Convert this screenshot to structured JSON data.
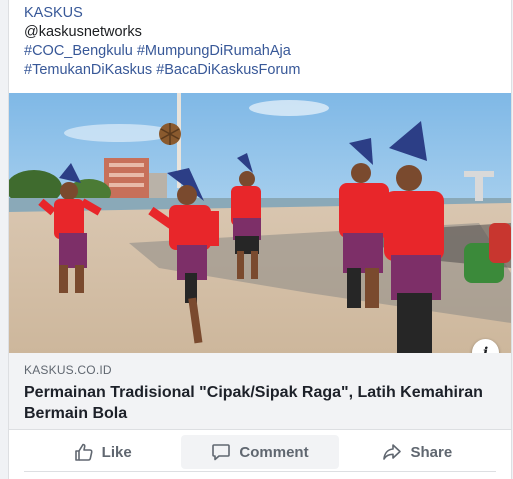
{
  "post": {
    "line1": "KASKUS",
    "line2": "@kaskusnetworks",
    "tags_line1": [
      "#COC_Bengkulu",
      "#MumpungDiRumahAja"
    ],
    "tags_line2": [
      "#TemukanDiKaskus",
      "#BacaDiKaskusForum"
    ]
  },
  "link_preview": {
    "domain": "KASKUS.CO.ID",
    "title": "Permainan Tradisional \"Cipak/Sipak Raga\", Latih Kemahiran Bermain Bola",
    "info_icon_label": "i"
  },
  "actions": {
    "like": "Like",
    "comment": "Comment",
    "share": "Share"
  },
  "icons": {
    "like": "thumbs-up-icon",
    "comment": "speech-bubble-icon",
    "share": "share-arrow-icon",
    "info": "info-icon"
  },
  "colors": {
    "hashtag": "#385898",
    "action_text": "#606770",
    "preview_bg": "#f2f3f5",
    "costume_red": "#e8262a",
    "sarong_purple": "#7d2f68"
  }
}
